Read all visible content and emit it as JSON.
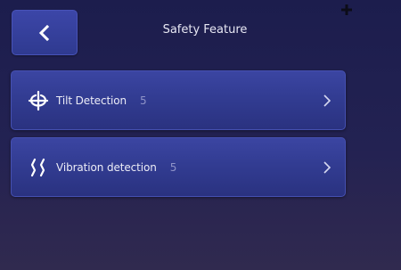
{
  "header": {
    "title": "Safety Feature",
    "back_icon": "chevron-left-icon"
  },
  "menu": {
    "items": [
      {
        "label": "Tilt Detection",
        "count": "5",
        "icon": "tilt-icon"
      },
      {
        "label": "Vibration detection",
        "count": "5",
        "icon": "vibration-icon"
      }
    ]
  },
  "colors": {
    "background": "#1c1d4d",
    "row": "#323c92",
    "button": "#3c46a8",
    "text": "#ececf6",
    "count": "#8f93c8"
  }
}
